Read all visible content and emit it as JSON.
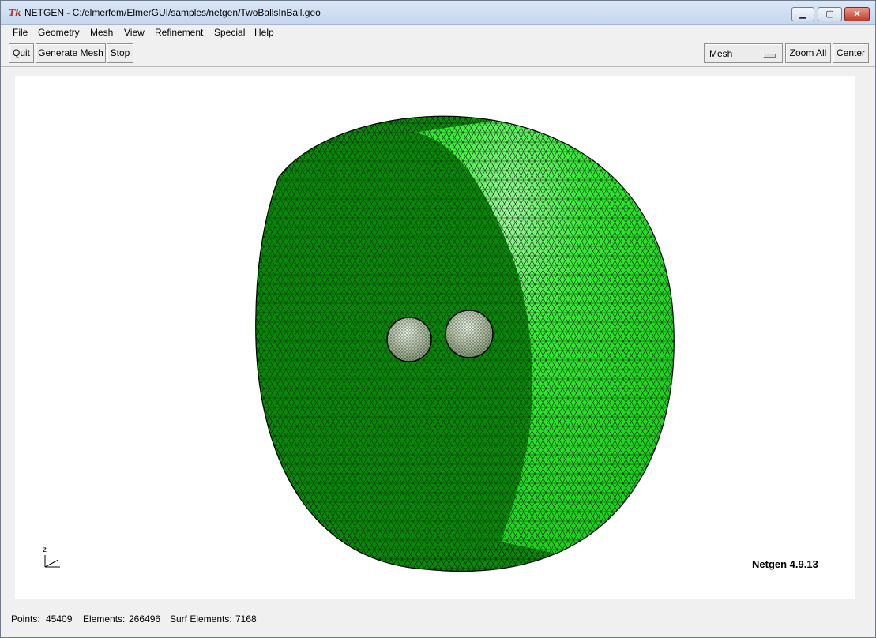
{
  "window": {
    "title": "NETGEN - C:/elmerfem/ElmerGUI/samples/netgen/TwoBallsInBall.geo",
    "app_icon": "tk-feather-icon",
    "controls": {
      "minimize": "minimize-icon",
      "maximize": "maximize-icon",
      "close": "close-icon"
    }
  },
  "menu": {
    "items": [
      "File",
      "Geometry",
      "Mesh",
      "View",
      "Refinement",
      "Special",
      "Help"
    ]
  },
  "toolbar": {
    "quit": "Quit",
    "generate_mesh": "Generate Mesh",
    "stop": "Stop",
    "view_select": {
      "value": "Mesh"
    },
    "zoom_all": "Zoom All",
    "center": "Center"
  },
  "viewport": {
    "version_label": "Netgen 4.9.13",
    "axes_label": "z",
    "colors": {
      "mesh_dark": "#0a8a0a",
      "mesh_light": "#22dd22",
      "edge": "#000000",
      "background": "#ffffff"
    }
  },
  "status": {
    "points_label": "Points:",
    "points": "45409",
    "elements_label": "Elements:",
    "elements": "266496",
    "surf_label": "Surf Elements:",
    "surf_elements": "7168"
  }
}
